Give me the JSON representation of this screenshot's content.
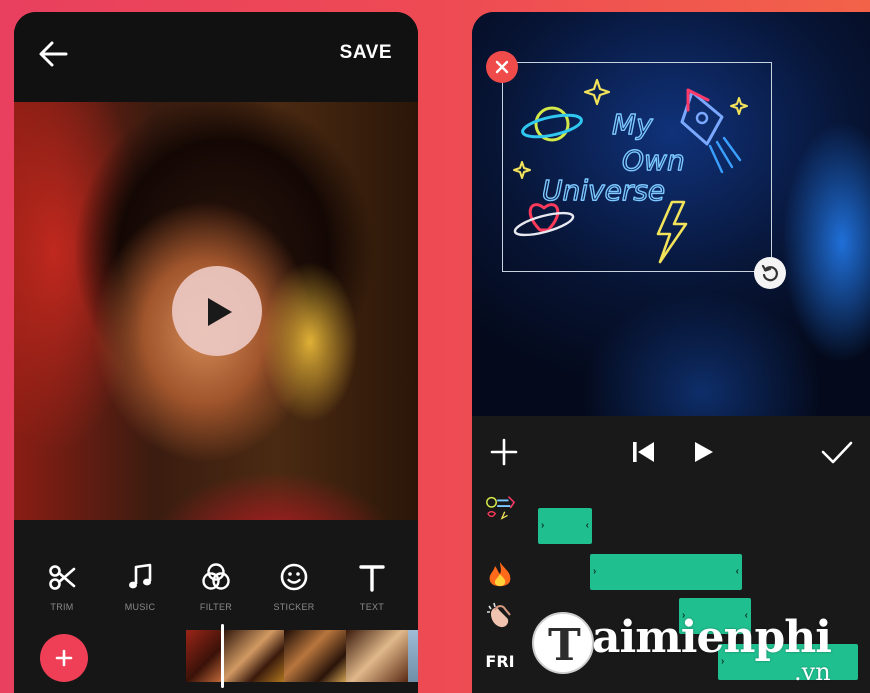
{
  "left_screen": {
    "header": {
      "back_icon": "arrow-left-icon",
      "save_label": "SAVE"
    },
    "video": {
      "play_icon": "play-icon"
    },
    "tools": [
      {
        "label": "TRIM",
        "icon": "scissors-icon"
      },
      {
        "label": "MUSIC",
        "icon": "music-note-icon"
      },
      {
        "label": "FILTER",
        "icon": "filter-icon"
      },
      {
        "label": "STICKER",
        "icon": "smiley-icon"
      },
      {
        "label": "TEXT",
        "icon": "text-icon"
      }
    ],
    "add_button": {
      "icon": "plus-icon",
      "color": "#ee3f56"
    }
  },
  "right_screen": {
    "sticker": {
      "text_lines": [
        "My",
        "Own",
        "Universe"
      ],
      "close_icon": "close-icon",
      "rotate_icon": "rotate-icon"
    },
    "controls": {
      "add_icon": "plus-icon",
      "skip_back_icon": "skip-back-icon",
      "play_icon": "play-icon",
      "confirm_icon": "check-icon"
    },
    "tracks": [
      {
        "icon": "universe-sticker-thumb"
      },
      {
        "icon": "fire-emoji-icon"
      },
      {
        "icon": "clapping-hands-emoji-icon"
      },
      {
        "label": "FRI"
      }
    ],
    "clip_color": "#1fbf8f"
  },
  "watermark": {
    "logo_letter": "T",
    "text": "aimienphi",
    "domain": ".vn"
  },
  "colors": {
    "background": "#ee4a54",
    "phone_bg": "#171717",
    "accent": "#ee3f56"
  }
}
